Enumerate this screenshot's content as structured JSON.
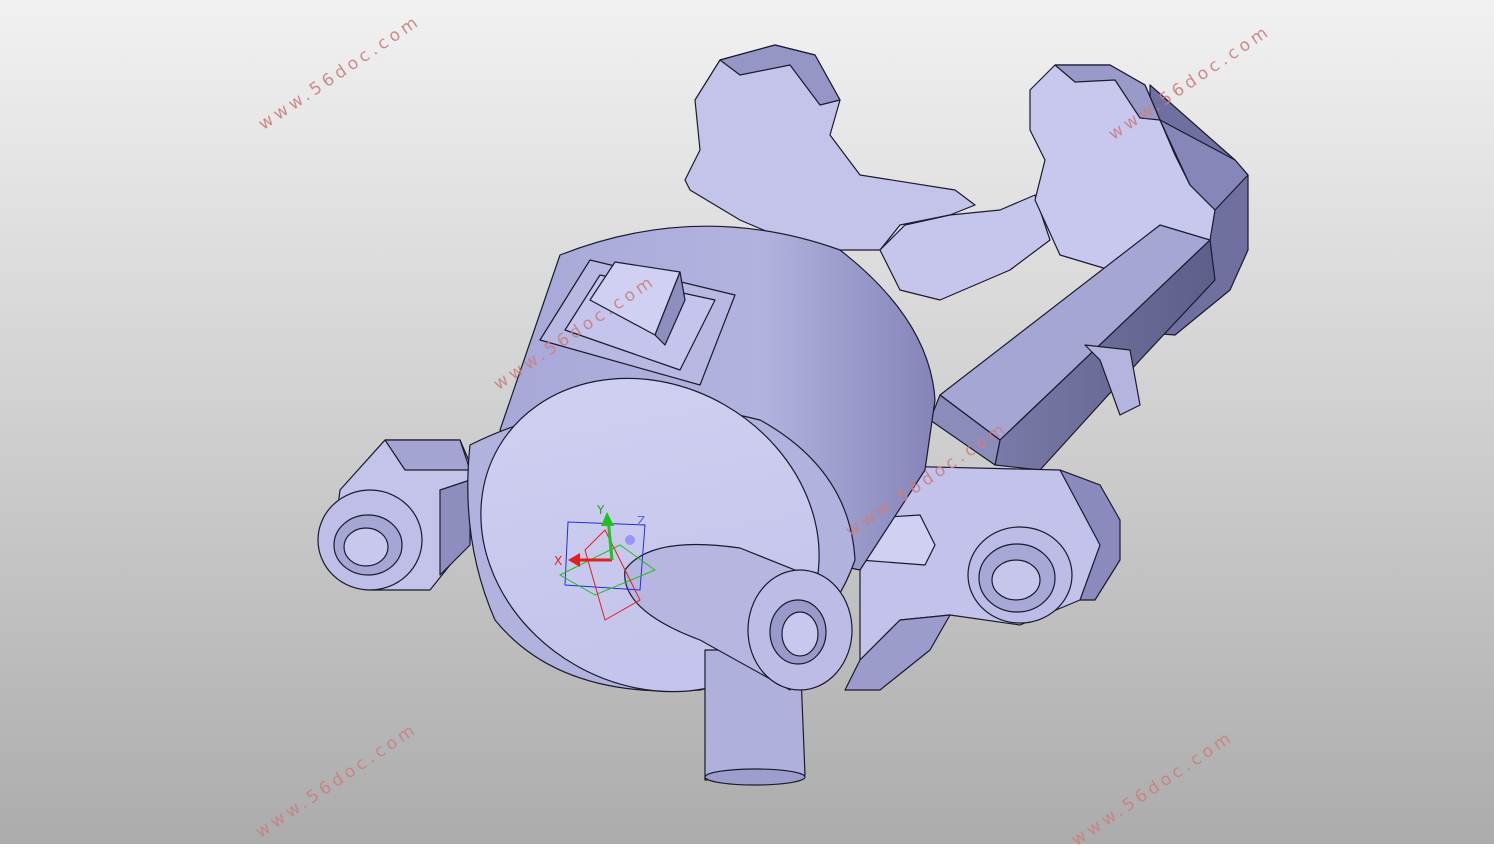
{
  "viewport": {
    "background_top": "#f1f1f1",
    "background_bottom": "#acacac"
  },
  "model": {
    "part_color": "#c8c8ec",
    "part_shadow": "#8e8ec2",
    "part_dark": "#6e6e9a",
    "edge_color": "#1a1a2e"
  },
  "triad": {
    "x_label": "X",
    "y_label": "Y",
    "z_label": "Z",
    "x_color": "#e02020",
    "y_color": "#20c020",
    "z_color": "#2030e0"
  },
  "watermarks": [
    {
      "text": "www.56doc.com"
    },
    {
      "text": "www.56doc.com"
    },
    {
      "text": "www.56doc.com"
    },
    {
      "text": "www.56doc.com"
    },
    {
      "text": "www.56doc.com"
    },
    {
      "text": "www.56doc.com"
    }
  ]
}
